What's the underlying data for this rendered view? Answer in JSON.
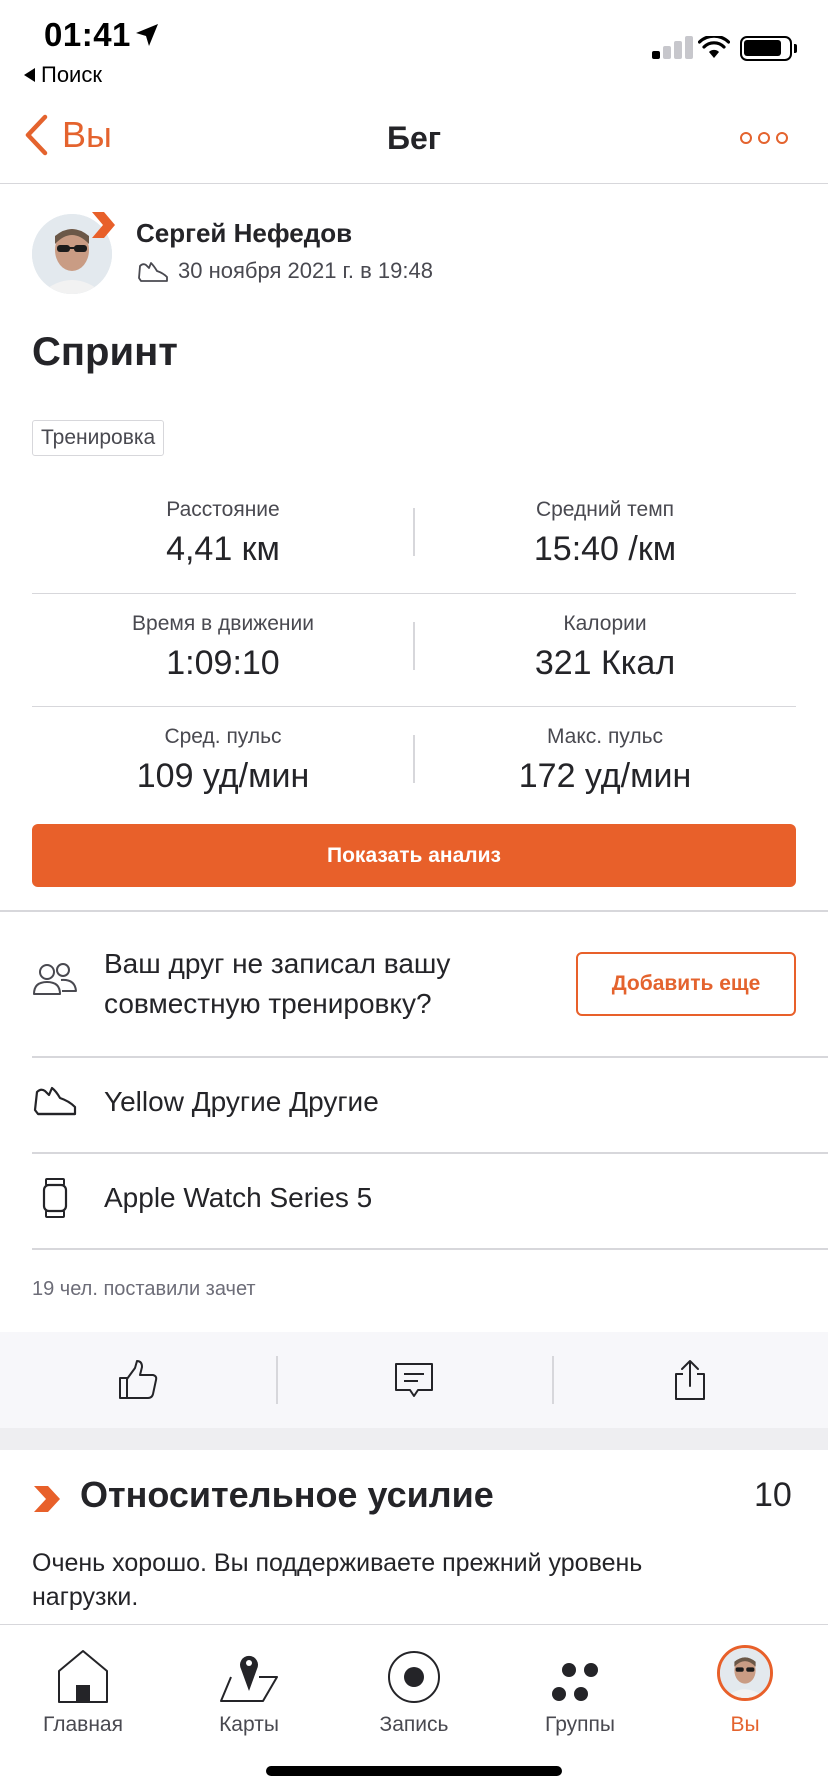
{
  "status_bar": {
    "time": "01:41",
    "back_app": "Поиск"
  },
  "nav": {
    "back_label": "Вы",
    "title": "Бег",
    "more_icon": "more-icon"
  },
  "athlete": {
    "name": "Сергей Нефедов",
    "date": "30 ноября 2021 г. в 19:48"
  },
  "activity": {
    "title": "Спринт",
    "tag": "Тренировка"
  },
  "stats": [
    {
      "left_label": "Расстояние",
      "left_value": "4,41 км",
      "right_label": "Средний темп",
      "right_value": "15:40 /км"
    },
    {
      "left_label": "Время в движении",
      "left_value": "1:09:10",
      "right_label": "Калории",
      "right_value": "321 Ккал"
    },
    {
      "left_label": "Сред. пульс",
      "left_value": "109 уд/мин",
      "right_label": "Макс. пульс",
      "right_value": "172 уд/мин"
    }
  ],
  "analysis_button": "Показать анализ",
  "friend_prompt": {
    "text": "Ваш друг не записал вашу совместную тренировку?",
    "button": "Добавить еще"
  },
  "gear": {
    "shoes": "Yellow Другие Другие",
    "device": "Apple Watch Series 5"
  },
  "kudos_text": "19 чел. поставили зачет",
  "relative_effort": {
    "title": "Относительное усилие",
    "value": "10",
    "description": "Очень хорошо. Вы поддерживаете прежний уровень нагрузки."
  },
  "tabs": [
    {
      "label": "Главная",
      "icon": "home-icon"
    },
    {
      "label": "Карты",
      "icon": "map-icon"
    },
    {
      "label": "Запись",
      "icon": "record-icon"
    },
    {
      "label": "Группы",
      "icon": "groups-icon"
    },
    {
      "label": "Вы",
      "icon": "avatar",
      "active": true
    }
  ],
  "colors": {
    "accent": "#e8602a",
    "text": "#242428",
    "divider": "#d7d7db"
  }
}
